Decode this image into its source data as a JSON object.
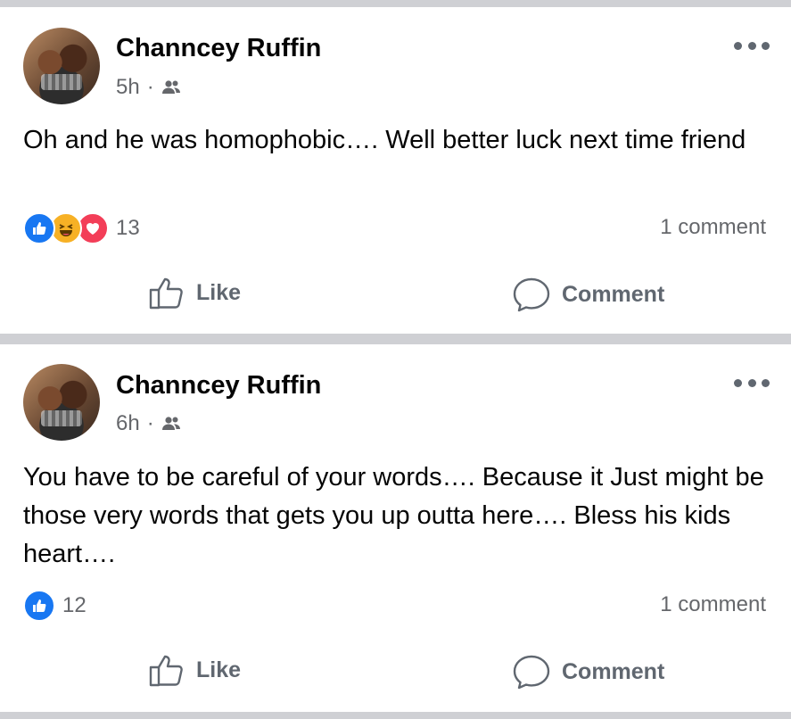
{
  "posts": [
    {
      "author": "Channcey Ruffin",
      "time": "5h",
      "audience_icon": "friends-icon",
      "text": "Oh and he was homophobic…. Well better luck next time friend",
      "reactions": [
        "like",
        "haha",
        "love"
      ],
      "reaction_count": "13",
      "comments": "1 comment",
      "like_label": "Like",
      "comment_label": "Comment"
    },
    {
      "author": "Channcey Ruffin",
      "time": "6h",
      "audience_icon": "friends-icon",
      "text": "You have to be careful of your words…. Because it Just might be those very words that gets you up outta here…. Bless his kids heart….",
      "reactions": [
        "like"
      ],
      "reaction_count": "12",
      "comments": "1 comment",
      "like_label": "Like",
      "comment_label": "Comment"
    }
  ],
  "colors": {
    "like_blue": "#1877f2",
    "haha_yellow": "#f7b125",
    "love_red": "#f33e58",
    "secondary_text": "#65676b",
    "separator": "#cfd0d4"
  }
}
